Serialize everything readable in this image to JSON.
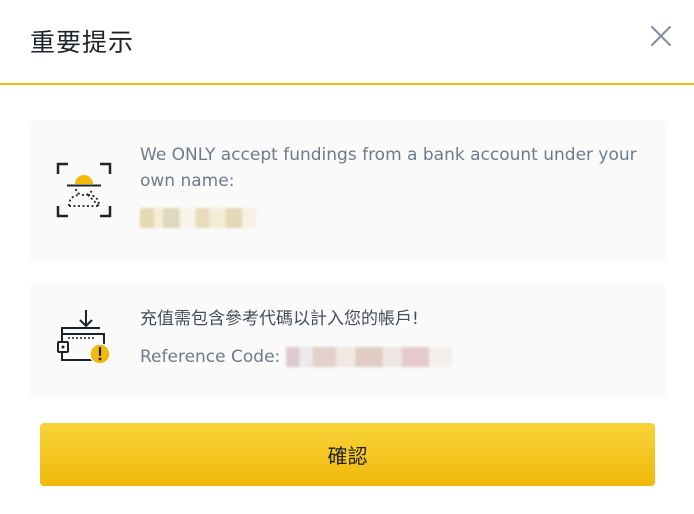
{
  "dialog": {
    "title": "重要提示",
    "close_icon": "close-icon"
  },
  "cards": {
    "own_account": {
      "icon": "user-scan-icon",
      "message": "We ONLY accept fundings from a bank account under your own name:"
    },
    "reference": {
      "icon": "wallet-deposit-warning-icon",
      "message": "充值需包含參考代碼以計入您的帳戶!",
      "reference_label": "Reference Code:"
    }
  },
  "actions": {
    "confirm_label": "確認"
  },
  "colors": {
    "accent": "#F0B90B",
    "card_bg": "#FAFAFA",
    "text_primary": "#1E2329",
    "text_secondary": "#707A8A"
  }
}
